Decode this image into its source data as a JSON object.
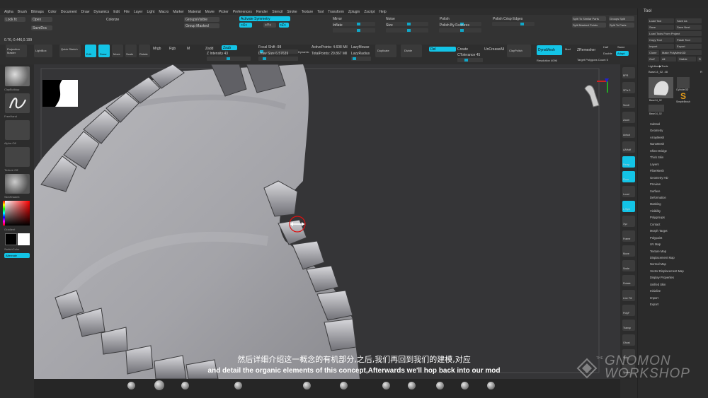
{
  "menubar": [
    "Alpha",
    "Brush",
    "Bitmaps",
    "Color",
    "Document",
    "Draw",
    "Dynamics",
    "Edit",
    "File",
    "Layer",
    "Light",
    "Macro",
    "Marker",
    "Material",
    "Movie",
    "Picker",
    "Preferences",
    "Render",
    "Stencil",
    "Stroke",
    "Texture",
    "Tool",
    "Transform",
    "Zplugin",
    "Zscript",
    "Help"
  ],
  "topstrip": {
    "lock": "Lock fx",
    "open": "Open",
    "saveDoc": "SaveDoc",
    "colorize": "Colorize",
    "groupvisible": "GroupsVisible",
    "groupmasked": "Group Masked",
    "activate_symmetry": "Activate Symmetry",
    "sym_x": ">X<",
    "sym_y": ">Y<",
    "sym_z": ">Z<",
    "mirror": "Mirror",
    "inflate": "Inflate",
    "polish": "Polish",
    "polish_by_features": "Polish By Features",
    "polish_crisp_edges": "Polish Crisp Edges",
    "split_similar": "Split To Similar Parts",
    "groups_split": "Groups Split",
    "split_masked": "Split Masked Points",
    "split_to_parts": "Split To Parts",
    "noise": "Noise",
    "size": "Size",
    "coords": "0.76,-0.446,0.199"
  },
  "toolbar2": {
    "projection_master": "Projection Master",
    "lightbox": "LightBox",
    "quick_sketch": "Quick Sketch",
    "edit": "Edit",
    "draw": "Draw",
    "move": "Move",
    "scale": "Scale",
    "rotate": "Rotate",
    "mrgb": "Mrgb",
    "rgb": "Rgb",
    "m": "M",
    "zadd": "Zadd",
    "zsub": "Zsub",
    "z_intensity": "Z Intensity 43",
    "focal_shift": "Focal Shift -98",
    "draw_size": "Draw Size 6.57639",
    "dynamic": "Dynamic",
    "active_points": "ActivePoints: 4.608 Mil",
    "total_points": "TotalPoints: 29.867 Mil",
    "lazymouse": "LazyMouse",
    "lazy_radius": "LazyRadius",
    "duplicate": "Duplicate",
    "divide": "Divide",
    "del": "Del",
    "create": "Create",
    "crease_tolerance": "CTolerance 45",
    "uncrease_all": "UnCreaseAll",
    "claypolish": "ClayPolish",
    "dynamesh": "DynaMesh",
    "resolution": "Resolution 4096",
    "zremesher": "ZRemesher",
    "target_polygons": "Target Polygons Count 5",
    "half": "Half",
    "same": "Same",
    "double": "Double",
    "adapt": "Adapt",
    "mod": "Mod"
  },
  "leftshelf": {
    "brush_caption": "ClayBuildup",
    "stroke_caption": "FreeHand",
    "alpha_caption": "Alpha Off",
    "texture_caption": "Texture Off",
    "material_caption": "SkinShade4",
    "gradient": "Gradient",
    "switch_color": "SwitchColor",
    "alternate": "Alternate"
  },
  "rightshelf": [
    "BPR",
    "SPix 3",
    "Scroll",
    "Zoom",
    "Actual",
    "AAHalf",
    "Persp",
    "Floor",
    "Local",
    "L.Sym",
    "Xyz",
    "Frame",
    "Move",
    "Scale",
    "Rotate",
    "Line Fill",
    "PolyF",
    "Transp",
    "Ghost",
    "Solo",
    "Xpose"
  ],
  "toolpanel": {
    "title": "Tool",
    "buttons": [
      "Load Tool",
      "Save As",
      "Save",
      "Save Next",
      "Load Tools From Project",
      "Copy Tool",
      "Paste Tool",
      "Import",
      "Export",
      "Clone",
      "Make PolyMesh3D",
      "GoZ",
      "All",
      "Visible",
      "R"
    ],
    "lightbox_tools": "Lightbox▶Tools",
    "current_tool": "Base14_02. 48",
    "r_label": "R",
    "thumb_captions": [
      "Base14_02",
      "Cylinder3D",
      "SimpleBrush",
      "Base14_02"
    ],
    "sections": [
      "Subtool",
      "Geometry",
      "ArrayMesh",
      "NanoMesh",
      "Shine Bridge",
      "Thick Skin",
      "Layers",
      "FiberMesh",
      "Geometry HD",
      "Preview",
      "Surface",
      "Deformation",
      "Masking",
      "Visibility",
      "Polygroups",
      "Contact",
      "Morph Target",
      "Polypaint",
      "UV Map",
      "Texture Map",
      "Displacement Map",
      "Normal Map",
      "Vector Displacement Map",
      "Display Properties",
      "Unified Skin",
      "Initialize",
      "Import",
      "Export"
    ]
  },
  "subtitle": {
    "zh": "然后详细介绍这一概念的有机部分,之后,我们再回到我们的建模,对应",
    "en": "and detail the organic elements of this concept,Afterwards we'll hop back into our mod"
  },
  "watermark": {
    "the": "THE",
    "line1": "GNOMON",
    "line2": "WORKSHOP"
  }
}
